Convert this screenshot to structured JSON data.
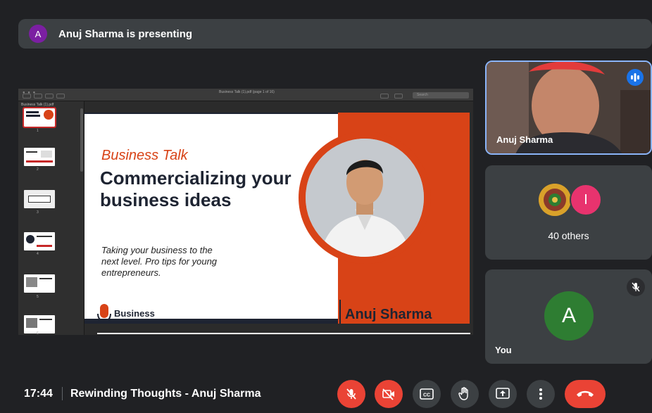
{
  "banner": {
    "avatar_letter": "A",
    "text": "Anuj Sharma is presenting"
  },
  "viewer": {
    "title": "Business Talk (1).pdf (page 1 of 16)",
    "search_placeholder": "Search",
    "panel_title": "Business Talk (1).pdf",
    "thumb_numbers": [
      "1",
      "2",
      "3",
      "4",
      "5",
      "6"
    ]
  },
  "slide": {
    "kicker": "Business Talk",
    "headline": "Commercializing your business ideas",
    "subtitle": "Taking your business to the next level. Pro tips for young entrepreneurs.",
    "brand": "Business Talk",
    "presenter_name": "Anuj Sharma"
  },
  "tiles": {
    "presenter_name": "Anuj Sharma",
    "others_letter": "I",
    "others_label": "40 others",
    "you_letter": "A",
    "you_label": "You"
  },
  "bottom": {
    "time": "17:44",
    "meeting_title": "Rewinding Thoughts - Anuj Sharma"
  },
  "colors": {
    "accent": "#d84317",
    "mute_red": "#ea4335",
    "speaking_blue": "#1a73e8",
    "presenter_border": "#8ab4f8"
  }
}
